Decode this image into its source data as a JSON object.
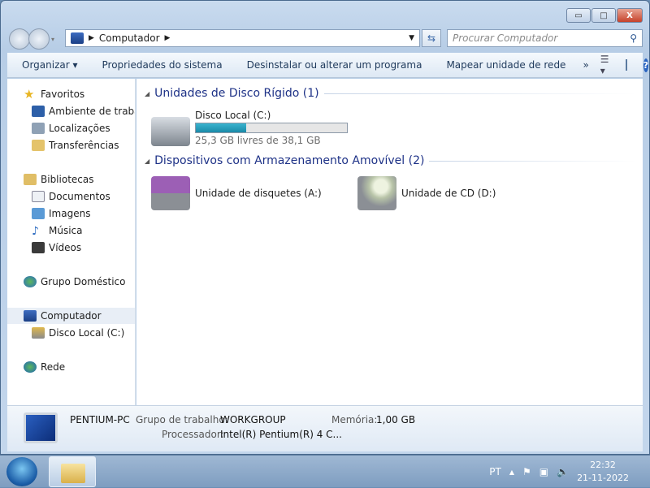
{
  "window": {
    "minimize": "▭",
    "maximize": "□",
    "close": "X"
  },
  "address": {
    "path": "Computador",
    "placeholder": "Procurar Computador"
  },
  "toolbar": {
    "organize": "Organizar ▾",
    "system_properties": "Propriedades do sistema",
    "uninstall": "Desinstalar ou alterar um programa",
    "map_drive": "Mapear unidade de rede",
    "more": "»"
  },
  "sidebar": {
    "favorites": "Favoritos",
    "desktop": "Ambiente de trabalho",
    "locations": "Localizações",
    "downloads": "Transferências",
    "libraries": "Bibliotecas",
    "documents": "Documentos",
    "images": "Imagens",
    "music": "Música",
    "videos": "Vídeos",
    "homegroup": "Grupo Doméstico",
    "computer": "Computador",
    "local_disk": "Disco Local (C:)",
    "network": "Rede"
  },
  "main": {
    "hdd_group": "Unidades de Disco Rígido (1)",
    "removable_group": "Dispositivos com Armazenamento Amovível (2)",
    "disk": {
      "name": "Disco Local (C:)",
      "free": "25,3 GB livres de 38,1 GB",
      "used_fraction": 0.336
    },
    "floppy": "Unidade de disquetes (A:)",
    "cd": "Unidade de CD (D:)"
  },
  "details": {
    "pc_name": "PENTIUM-PC",
    "workgroup_label": "Grupo de trabalho:",
    "workgroup": "WORKGROUP",
    "memory_label": "Memória:",
    "memory": "1,00 GB",
    "cpu_label": "Processador:",
    "cpu": "Intel(R) Pentium(R) 4 C..."
  },
  "taskbar": {
    "lang": "PT",
    "time": "22:32",
    "date": "21-11-2022"
  }
}
